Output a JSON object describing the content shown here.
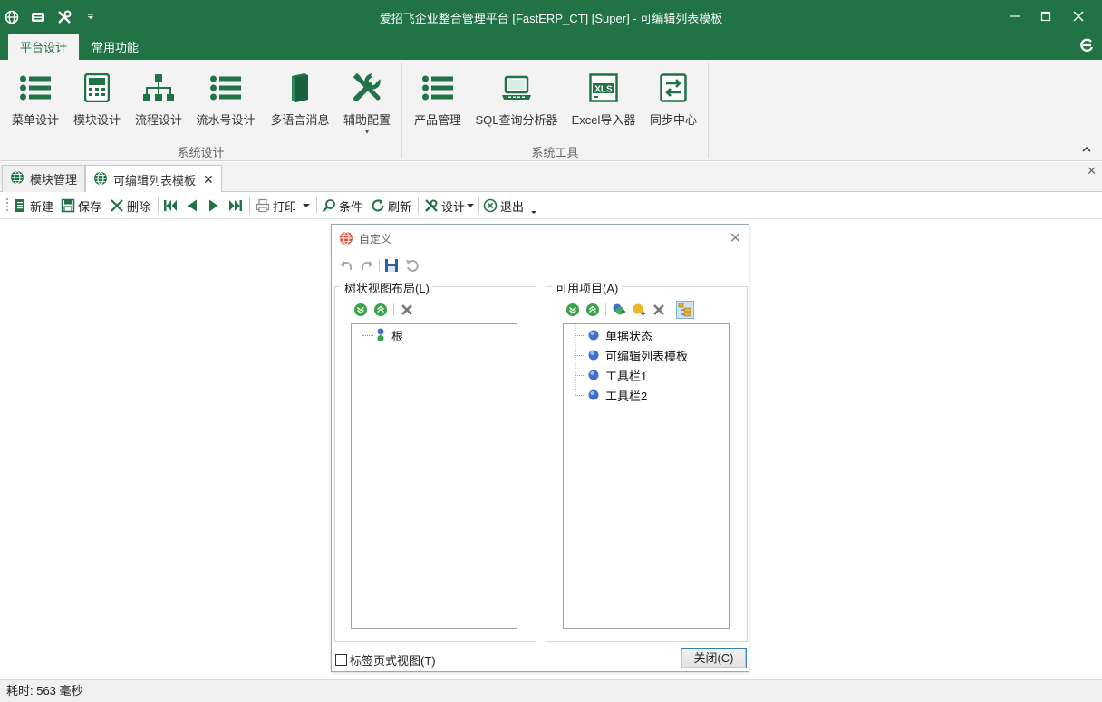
{
  "window": {
    "title": "爱招飞企业整合管理平台 [FastERP_CT] [Super] - 可编辑列表模板",
    "accent_color": "#217346"
  },
  "ribbon": {
    "tabs": [
      {
        "label": "平台设计",
        "active": true
      },
      {
        "label": "常用功能",
        "active": false
      }
    ],
    "groups": [
      {
        "label": "系统设计",
        "buttons": [
          {
            "label": "菜单设计",
            "icon": "list-icon"
          },
          {
            "label": "模块设计",
            "icon": "calculator-icon"
          },
          {
            "label": "流程设计",
            "icon": "org-chart-icon"
          },
          {
            "label": "流水号设计",
            "icon": "list-icon"
          },
          {
            "label": "多语言消息",
            "icon": "book-icon"
          },
          {
            "label": "辅助配置",
            "icon": "tools-icon",
            "dropdown": "▾"
          }
        ]
      },
      {
        "label": "系统工具",
        "buttons": [
          {
            "label": "产品管理",
            "icon": "list-icon"
          },
          {
            "label": "SQL查询分析器",
            "icon": "laptop-icon"
          },
          {
            "label": "Excel导入器",
            "icon": "xls-icon",
            "badge": "XLS"
          },
          {
            "label": "同步中心",
            "icon": "sync-icon"
          }
        ]
      }
    ]
  },
  "doc_tabs": [
    {
      "label": "模块管理",
      "active": false
    },
    {
      "label": "可编辑列表模板",
      "active": true,
      "close": "✕"
    }
  ],
  "doc_close": "✕",
  "toolbar": {
    "new": "新建",
    "save": "保存",
    "delete": "删除",
    "print": "打印",
    "condition": "条件",
    "refresh": "刷新",
    "design": "设计",
    "exit": "退出"
  },
  "dialog": {
    "title": "自定义",
    "close": "✕",
    "tree_layout": {
      "legend": "树状视图布局(L)",
      "nodes": [
        "根"
      ]
    },
    "available": {
      "legend": "可用项目(A)",
      "nodes": [
        "单据状态",
        "可编辑列表模板",
        "工具栏1",
        "工具栏2"
      ]
    },
    "checkbox_label": "标签页式视图(T)",
    "checkbox_checked": false,
    "close_button": "关闭(C)"
  },
  "status": {
    "text": "耗时: 563 毫秒"
  }
}
